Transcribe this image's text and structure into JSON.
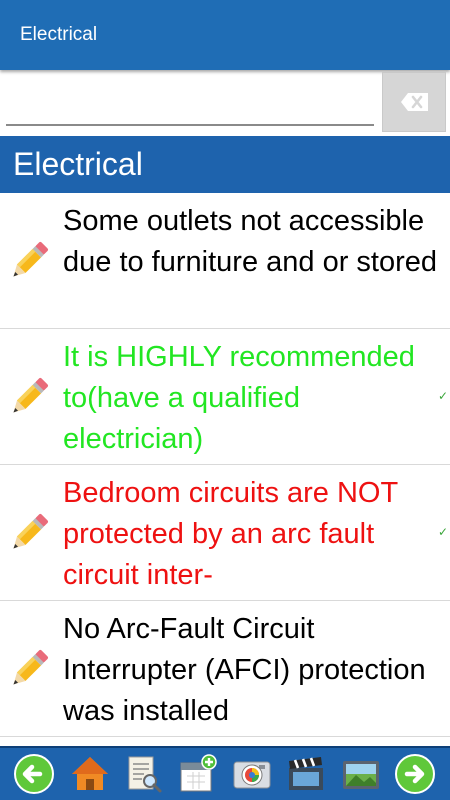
{
  "app_bar": {
    "title": "Electrical"
  },
  "search": {
    "value": "",
    "placeholder": ""
  },
  "section": {
    "title": "Electrical"
  },
  "items": [
    {
      "text": "Some outlets not accessible due to furniture and or stored",
      "color": "#000000",
      "checked": false
    },
    {
      "text": "It is HIGHLY recommended to(have a qualified electrician)",
      "color": "#22e622",
      "checked": true
    },
    {
      "text": "Bedroom circuits are NOT protected by an arc fault circuit inter-",
      "color": "#ee1111",
      "checked": true
    },
    {
      "text": "No Arc-Fault Circuit Interrupter (AFCI) protection was installed",
      "color": "#000000",
      "checked": false
    }
  ],
  "check_glyph": "✓",
  "toolbar_icons": [
    "back-arrow-icon",
    "home-icon",
    "document-search-icon",
    "calendar-add-icon",
    "camera-icon",
    "video-clapper-icon",
    "photo-gallery-icon",
    "forward-arrow-icon"
  ],
  "colors": {
    "app_bar": "#1f6db5",
    "section_header": "#1e63ad",
    "toolbar": "#1e63ad"
  }
}
